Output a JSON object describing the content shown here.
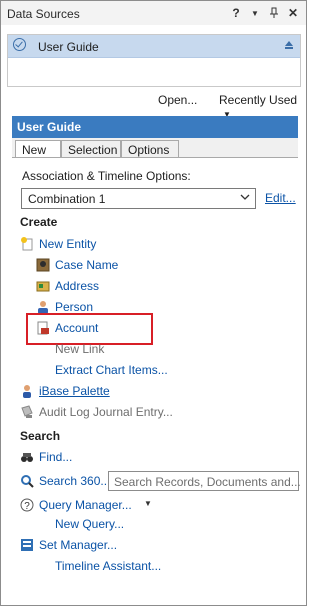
{
  "window": {
    "title": "Data Sources",
    "help": "?",
    "menu_caret": "▼",
    "pin": "⊥",
    "close": "✕"
  },
  "datasources": {
    "selected": "User Guide"
  },
  "toolbar": {
    "open_label": "Open...",
    "recent_label": "Recently Used",
    "recent_caret": "▼"
  },
  "guide": {
    "header": "User Guide",
    "tabs": [
      {
        "label": "New"
      },
      {
        "label": "Selection"
      },
      {
        "label": "Options"
      }
    ],
    "assoc_label": "Association & Timeline Options:",
    "combo_value": "Combination 1",
    "edit_label": "Edit..."
  },
  "create": {
    "heading": "Create",
    "new_entity": "New Entity",
    "case_name": "Case Name",
    "address": "Address",
    "person": "Person",
    "account": "Account",
    "new_link": "New Link",
    "extract": "Extract Chart Items...",
    "palette": "iBase Palette",
    "audit": "Audit Log Journal Entry..."
  },
  "search": {
    "heading": "Search",
    "find": "Find...",
    "search360": "Search 360...",
    "search_placeholder": "Search Records, Documents and...",
    "query_manager": "Query Manager...",
    "new_query": "New Query...",
    "set_manager": "Set Manager...",
    "timeline_assistant": "Timeline Assistant..."
  },
  "icons": {
    "check": "check-circle-icon",
    "eject": "eject-icon",
    "new_entity": "new-entity-icon",
    "case": "case-icon",
    "address": "address-icon",
    "person": "person-icon",
    "account": "account-icon",
    "palette": "palette-icon",
    "audit": "audit-icon",
    "find": "binoculars-icon",
    "search360": "search360-icon",
    "query": "query-icon",
    "set": "set-manager-icon"
  }
}
